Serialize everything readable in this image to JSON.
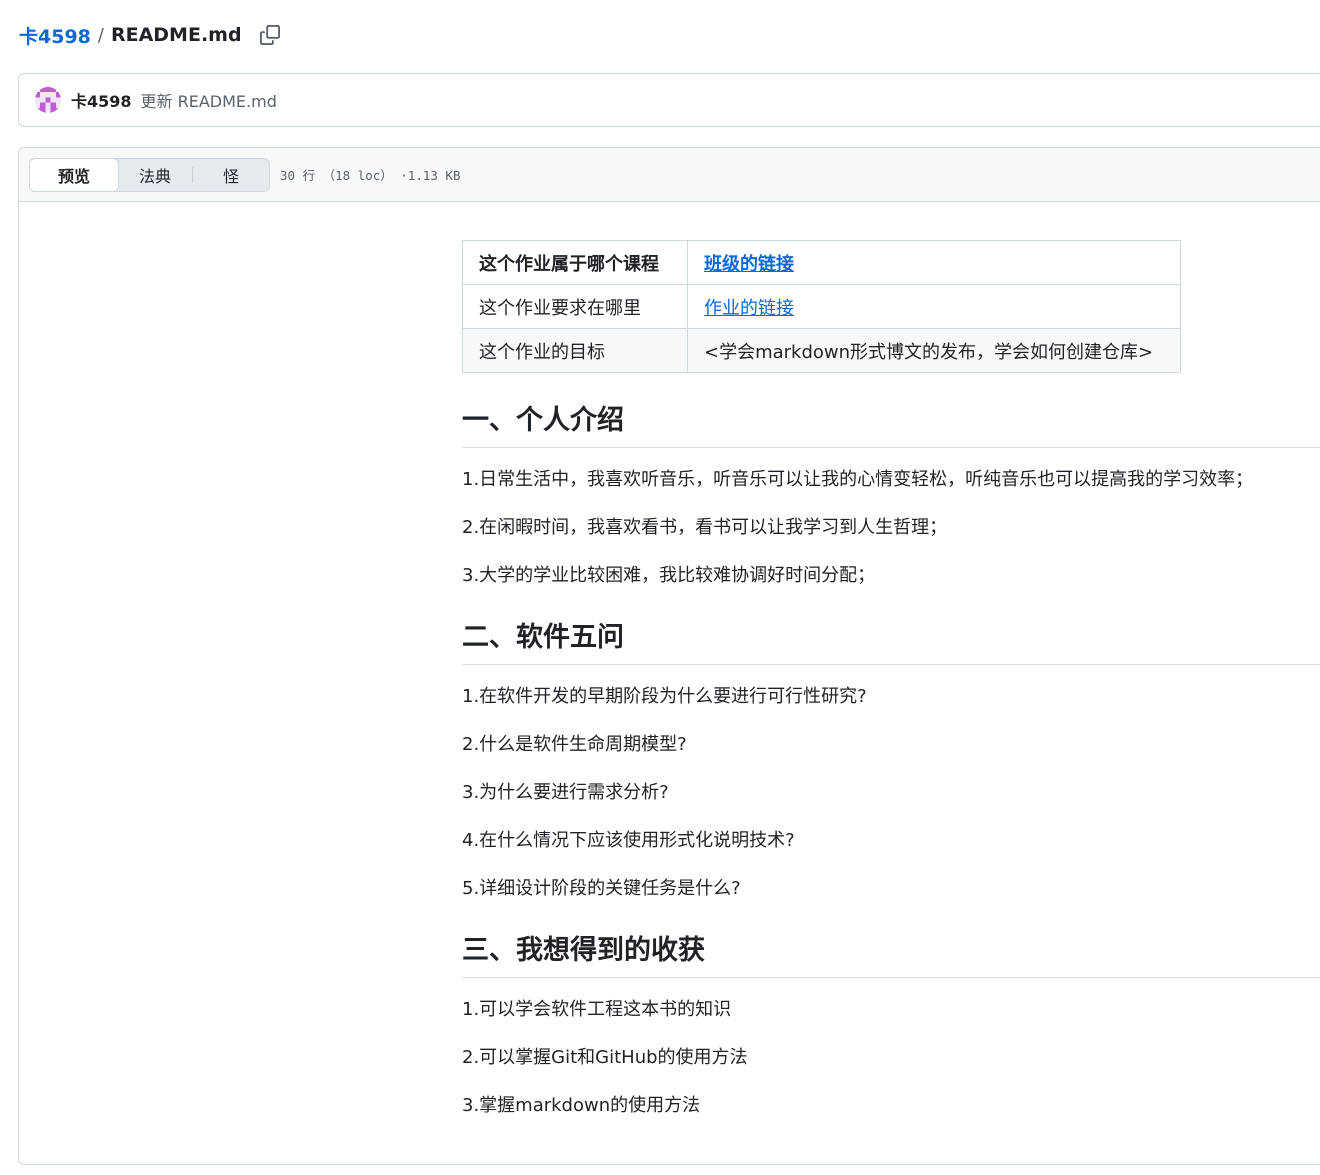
{
  "breadcrumb": {
    "owner": "卡4598",
    "separator": "/",
    "file": "README.md"
  },
  "commit": {
    "author": "卡4598",
    "message": "更新 README.md"
  },
  "file_header": {
    "tabs": [
      "预览",
      "法典",
      "怪"
    ],
    "active_tab": "预览",
    "meta": "30 行 （18 loc） ·1.13 KB"
  },
  "readme": {
    "table": [
      {
        "label": "这个作业属于哪个课程",
        "value": "班级的链接",
        "is_link": true
      },
      {
        "label": "这个作业要求在哪里",
        "value": "作业的链接",
        "is_link": true
      },
      {
        "label": "这个作业的目标",
        "value": "<学会markdown形式博文的发布，学会如何创建仓库>",
        "is_link": false
      }
    ],
    "sections": [
      {
        "heading": "一、个人介绍",
        "items": [
          "1.日常生活中，我喜欢听音乐，听音乐可以让我的心情变轻松，听纯音乐也可以提高我的学习效率；",
          "2.在闲暇时间，我喜欢看书，看书可以让我学习到人生哲理；",
          "3.大学的学业比较困难，我比较难协调好时间分配；"
        ]
      },
      {
        "heading": "二、软件五问",
        "items": [
          "1.在软件开发的早期阶段为什么要进行可行性研究?",
          "2.什么是软件生命周期模型?",
          "3.为什么要进行需求分析?",
          "4.在什么情况下应该使用形式化说明技术?",
          "5.详细设计阶段的关键任务是什么?"
        ]
      },
      {
        "heading": "三、我想得到的收获",
        "items": [
          "1.可以学会软件工程这本书的知识",
          "2.可以掌握Git和GitHub的使用方法",
          "3.掌握markdown的使用方法"
        ]
      }
    ]
  },
  "icons": {
    "copy": "copy-icon",
    "avatar": "identicon-avatar"
  },
  "colors": {
    "link": "#0969da",
    "border": "#d1d9e0",
    "header_bg": "#f6f8fa"
  }
}
